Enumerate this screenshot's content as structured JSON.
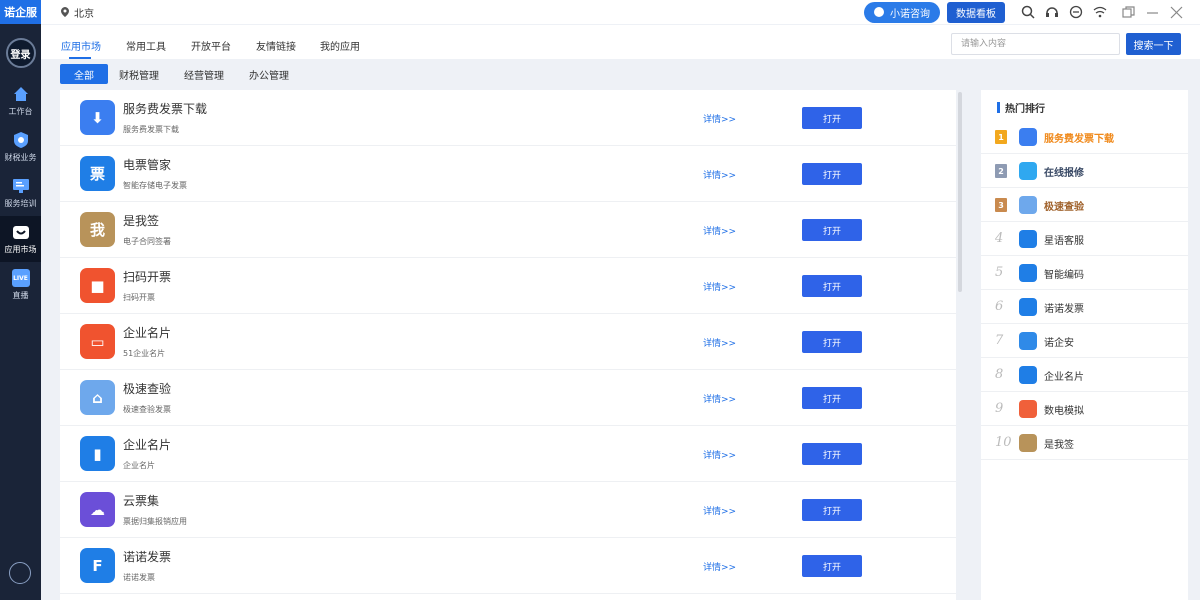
{
  "sidebar": {
    "brand": "诺企服",
    "login": "登录",
    "items": [
      {
        "label": "工作台",
        "icon": "home-icon"
      },
      {
        "label": "财税业务",
        "icon": "tax-icon"
      },
      {
        "label": "服务培训",
        "icon": "training-icon"
      },
      {
        "label": "应用市场",
        "icon": "app-market-icon",
        "active": true
      },
      {
        "label": "直播",
        "icon": "live-icon",
        "badge": "LIVE"
      }
    ]
  },
  "topbar": {
    "location": "北京",
    "consult": "小诺咨询",
    "dashboard": "数据看板"
  },
  "tabs": [
    "应用市场",
    "常用工具",
    "开放平台",
    "友情链接",
    "我的应用"
  ],
  "search": {
    "placeholder": "请输入内容",
    "button": "搜索一下"
  },
  "subtabs": [
    "全部",
    "财税管理",
    "经营管理",
    "办公管理"
  ],
  "apps": [
    {
      "name": "服务费发票下载",
      "desc": "服务费发票下载",
      "icon_char": "⬇",
      "color": "#3b7ef0",
      "detail": "详情>>",
      "open": "打开"
    },
    {
      "name": "电票管家",
      "desc": "智能存储电子发票",
      "icon_char": "票",
      "color": "#1f7ee6",
      "detail": "详情>>",
      "open": "打开"
    },
    {
      "name": "是我签",
      "desc": "电子合同签署",
      "icon_char": "我",
      "color": "#b8935a",
      "detail": "详情>>",
      "open": "打开"
    },
    {
      "name": "扫码开票",
      "desc": "扫码开票",
      "icon_char": "■",
      "color": "#f0532f",
      "detail": "详情>>",
      "open": "打开"
    },
    {
      "name": "企业名片",
      "desc": "51企业名片",
      "icon_char": "▭",
      "color": "#f0532f",
      "detail": "详情>>",
      "open": "打开"
    },
    {
      "name": "极速查验",
      "desc": "极速查验发票",
      "icon_char": "⌂",
      "color": "#6ea8ec",
      "detail": "详情>>",
      "open": "打开"
    },
    {
      "name": "企业名片",
      "desc": "企业名片",
      "icon_char": "▮",
      "color": "#1f7ee6",
      "detail": "详情>>",
      "open": "打开"
    },
    {
      "name": "云票集",
      "desc": "票据归集报销应用",
      "icon_char": "☁",
      "color": "#6b4fd8",
      "detail": "详情>>",
      "open": "打开"
    },
    {
      "name": "诺诺发票",
      "desc": "诺诺发票",
      "icon_char": "F",
      "color": "#1f7ee6",
      "detail": "详情>>",
      "open": "打开"
    }
  ],
  "ranking": {
    "title": "热门排行",
    "items": [
      {
        "rank": "1",
        "label": "服务费发票下载",
        "color": "#3b7ef0",
        "label_color": "#f08a1c",
        "medal": "#f2a81e"
      },
      {
        "rank": "2",
        "label": "在线报修",
        "color": "#2fa8f0",
        "label_color": "#3a4a66",
        "medal": "#8e9bb3"
      },
      {
        "rank": "3",
        "label": "极速查验",
        "color": "#6ea8ec",
        "label_color": "#a0622c",
        "medal": "#c98a4e"
      },
      {
        "rank": "4",
        "label": "星语客服",
        "color": "#1f7ee6",
        "label_color": "#333333"
      },
      {
        "rank": "5",
        "label": "智能编码",
        "color": "#1f7ee6",
        "label_color": "#333333"
      },
      {
        "rank": "6",
        "label": "诺诺发票",
        "color": "#1f7ee6",
        "label_color": "#333333"
      },
      {
        "rank": "7",
        "label": "诺企安",
        "color": "#2f8ae8",
        "label_color": "#333333"
      },
      {
        "rank": "8",
        "label": "企业名片",
        "color": "#1f7ee6",
        "label_color": "#333333"
      },
      {
        "rank": "9",
        "label": "数电模拟",
        "color": "#f0603a",
        "label_color": "#333333"
      },
      {
        "rank": "10",
        "label": "是我签",
        "color": "#b8935a",
        "label_color": "#333333"
      }
    ]
  }
}
